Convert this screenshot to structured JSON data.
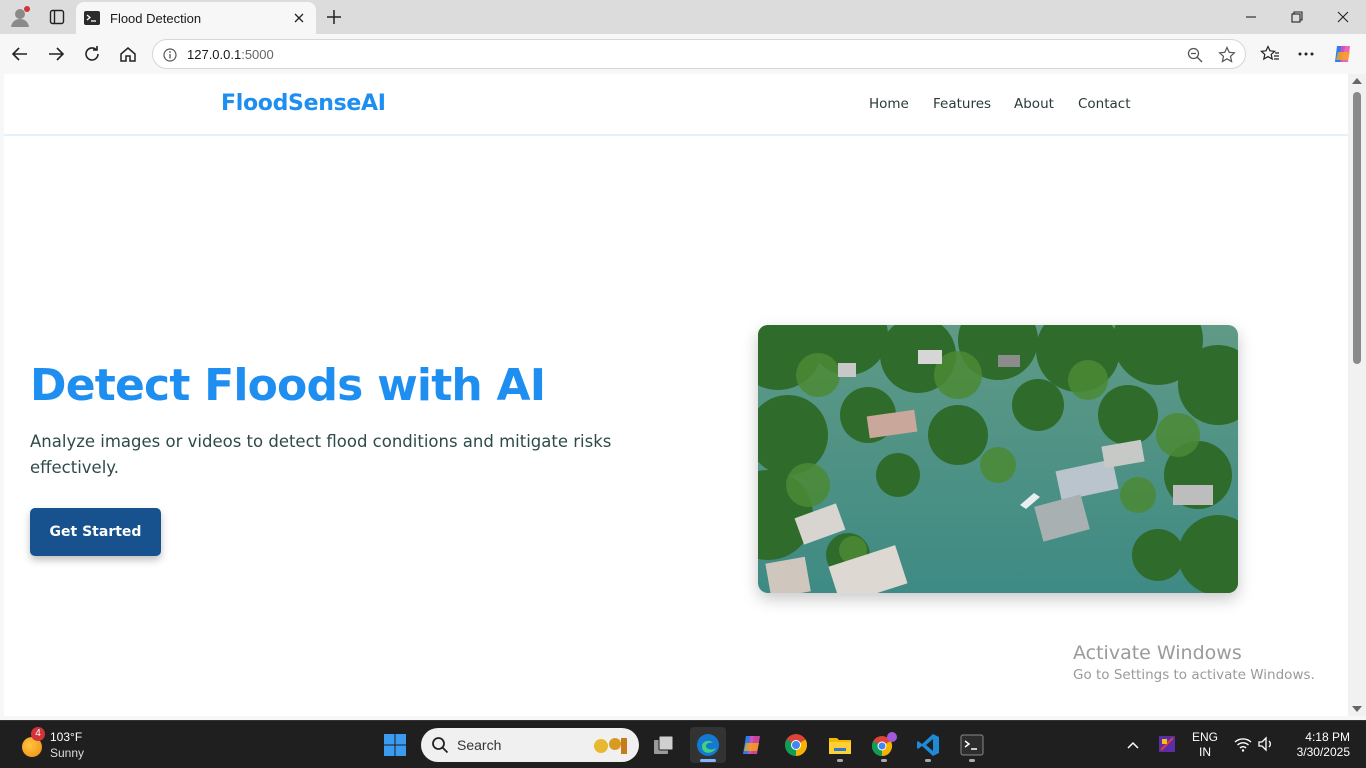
{
  "browser": {
    "tab_title": "Flood Detection",
    "url_host": "127.0.0.1",
    "url_port": ":5000"
  },
  "site": {
    "logo": "FloodSenseAI",
    "nav": [
      "Home",
      "Features",
      "About",
      "Contact"
    ],
    "hero_title": "Detect Floods with AI",
    "hero_subtitle": "Analyze images or videos to detect flood conditions and mitigate risks effectively.",
    "cta_label": "Get Started",
    "brand_color": "#1e8ff0",
    "cta_color": "#17528f"
  },
  "watermark": {
    "line1": "Activate Windows",
    "line2": "Go to Settings to activate Windows."
  },
  "taskbar": {
    "weather_badge": "4",
    "weather_temp": "103°F",
    "weather_cond": "Sunny",
    "search_label": "Search",
    "lang_line1": "ENG",
    "lang_line2": "IN",
    "time": "4:18 PM",
    "date": "3/30/2025"
  },
  "icons": [
    "profile-icon",
    "tab-actions-icon",
    "terminal-favicon-icon",
    "close-icon",
    "new-tab-icon",
    "minimize-icon",
    "restore-icon",
    "back-icon",
    "forward-icon",
    "refresh-icon",
    "home-icon",
    "info-icon",
    "zoom-icon",
    "favorite-star-icon",
    "favorites-icon",
    "more-icon",
    "copilot-icon",
    "windows-start-icon",
    "search-icon",
    "task-view-icon",
    "edge-icon",
    "copilot-app-icon",
    "chrome-icon",
    "file-explorer-icon",
    "chrome-profile-icon",
    "vscode-icon",
    "terminal-icon",
    "chevron-up-icon",
    "security-icon",
    "wifi-icon",
    "volume-icon"
  ]
}
